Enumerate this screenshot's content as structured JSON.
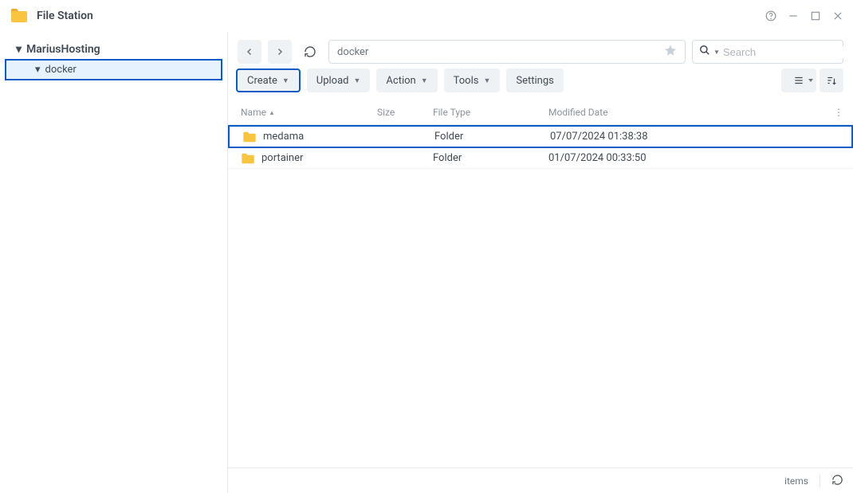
{
  "app": {
    "title": "File Station"
  },
  "sidebar": {
    "root": {
      "label": "MariusHosting"
    },
    "child": {
      "label": "docker"
    }
  },
  "breadcrumb": {
    "path": "docker"
  },
  "search": {
    "placeholder": "Search"
  },
  "toolbar": {
    "create": "Create",
    "upload": "Upload",
    "action": "Action",
    "tools": "Tools",
    "settings": "Settings"
  },
  "columns": {
    "name": "Name",
    "size": "Size",
    "type": "File Type",
    "modified": "Modified Date"
  },
  "rows": [
    {
      "name": "medama",
      "size": "",
      "type": "Folder",
      "modified": "07/07/2024 01:38:38",
      "selected": true
    },
    {
      "name": "portainer",
      "size": "",
      "type": "Folder",
      "modified": "01/07/2024 00:33:50",
      "selected": false
    }
  ],
  "statusbar": {
    "items": "items"
  }
}
